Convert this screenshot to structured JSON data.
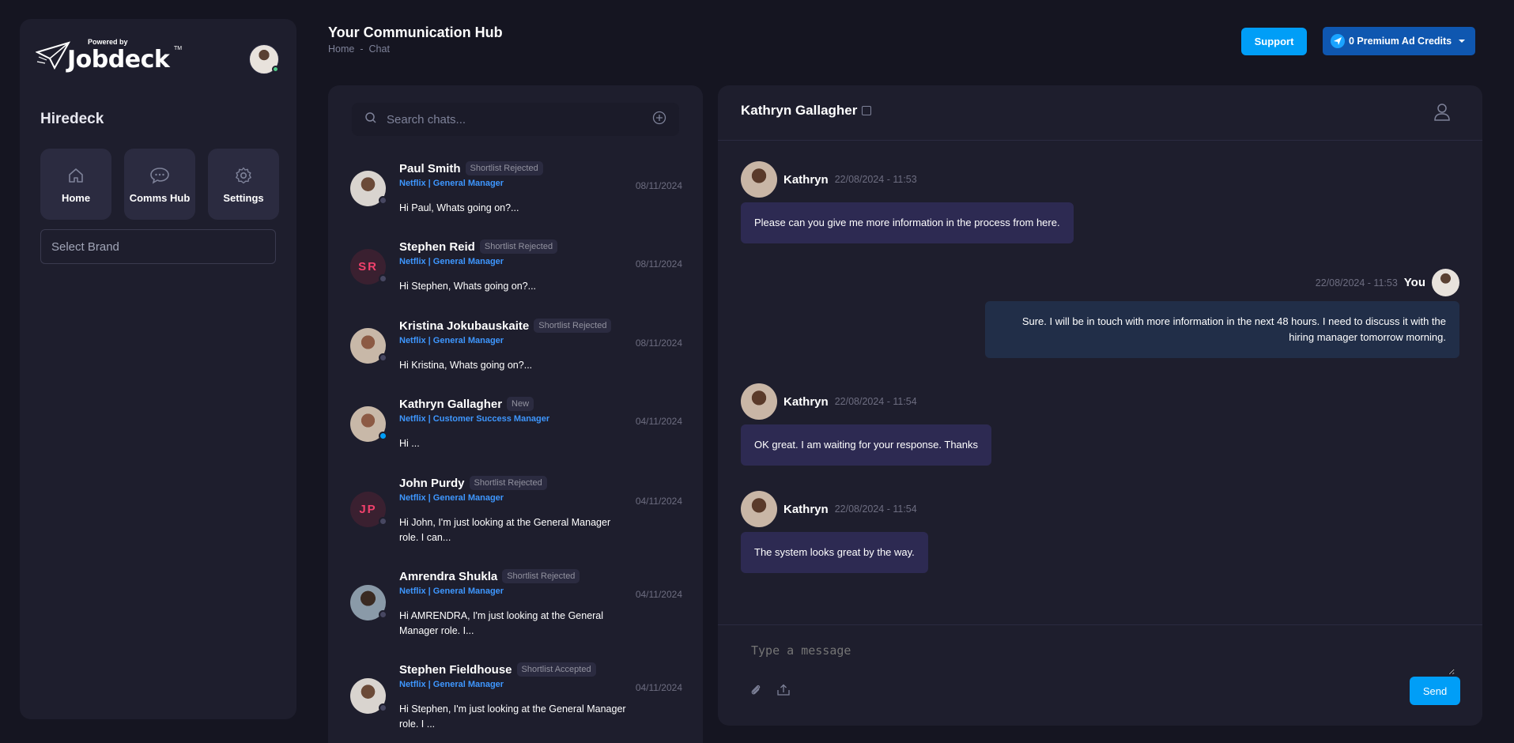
{
  "sidebar": {
    "logo_powered": "Powered by",
    "logo_brand": "Jobdeck",
    "logo_tm": "TM",
    "org_name": "Hiredeck",
    "tiles": [
      {
        "label": "Home",
        "icon": "home-icon"
      },
      {
        "label": "Comms Hub",
        "icon": "chat-bubble-icon"
      },
      {
        "label": "Settings",
        "icon": "gear-icon"
      }
    ],
    "select_brand_placeholder": "Select Brand"
  },
  "header": {
    "title": "Your Communication Hub",
    "breadcrumb": [
      "Home",
      "-",
      "Chat"
    ],
    "support_label": "Support",
    "credits_label": "0 Premium Ad Credits"
  },
  "chat_list": {
    "search_placeholder": "Search chats...",
    "contacts": [
      {
        "name": "Paul Smith",
        "badge": "Shortlist Rejected",
        "role": "Netflix | General Manager",
        "message": "Hi Paul, Whats going on?...",
        "date": "08/11/2024",
        "avatar": "photo",
        "online": false
      },
      {
        "name": "Stephen Reid",
        "badge": "Shortlist Rejected",
        "role": "Netflix | General Manager",
        "message": "Hi Stephen, Whats going on?...",
        "date": "08/11/2024",
        "avatar": "initials",
        "initials": "SR",
        "online": false
      },
      {
        "name": "Kristina Jokubauskaite",
        "badge": "Shortlist Rejected",
        "role": "Netflix | General Manager",
        "message": "Hi Kristina, Whats going on?...",
        "date": "08/11/2024",
        "avatar": "photo",
        "online": false
      },
      {
        "name": "Kathryn Gallagher",
        "badge": "New",
        "role": "Netflix | Customer Success Manager",
        "message": "Hi ...",
        "date": "04/11/2024",
        "avatar": "photo",
        "online": true
      },
      {
        "name": "John Purdy",
        "badge": "Shortlist Rejected",
        "role": "Netflix | General Manager",
        "message": "Hi John, I'm just looking at the General Manager role. I can...",
        "date": "04/11/2024",
        "avatar": "initials",
        "initials": "JP",
        "online": false
      },
      {
        "name": "Amrendra Shukla",
        "badge": "Shortlist Rejected",
        "role": "Netflix | General Manager",
        "message": "Hi AMRENDRA, I'm just looking at the General Manager role. I...",
        "date": "04/11/2024",
        "avatar": "photo",
        "online": false
      },
      {
        "name": "Stephen Fieldhouse",
        "badge": "Shortlist Accepted",
        "role": "Netflix | General Manager",
        "message": "Hi Stephen, I'm just looking at the General Manager role. I ...",
        "date": "04/11/2024",
        "avatar": "photo",
        "online": false
      }
    ]
  },
  "conversation": {
    "contact_name": "Kathryn Gallagher",
    "messages": [
      {
        "sender": "Kathryn",
        "time": "22/08/2024 - 11:53",
        "text": "Please can you give me more information in the process from here.",
        "direction": "in"
      },
      {
        "sender": "You",
        "time": "22/08/2024 - 11:53",
        "text": "Sure. I will be in touch with more information in the next 48 hours. I need to discuss it with the hiring manager tomorrow morning.",
        "direction": "out"
      },
      {
        "sender": "Kathryn",
        "time": "22/08/2024 - 11:54",
        "text": "OK great. I am waiting for your response. Thanks",
        "direction": "in"
      },
      {
        "sender": "Kathryn",
        "time": "22/08/2024 - 11:54",
        "text": "The system looks great by the way.",
        "direction": "in"
      }
    ],
    "composer_placeholder": "Type a message",
    "send_label": "Send"
  },
  "colors": {
    "background": "#151521",
    "panel": "#1e1e2d",
    "primary": "#009ef7",
    "incoming_bubble": "#2d2a52",
    "outgoing_bubble": "#212e48",
    "link_blue": "#3e97ff",
    "initials_red": "#f1416c"
  }
}
